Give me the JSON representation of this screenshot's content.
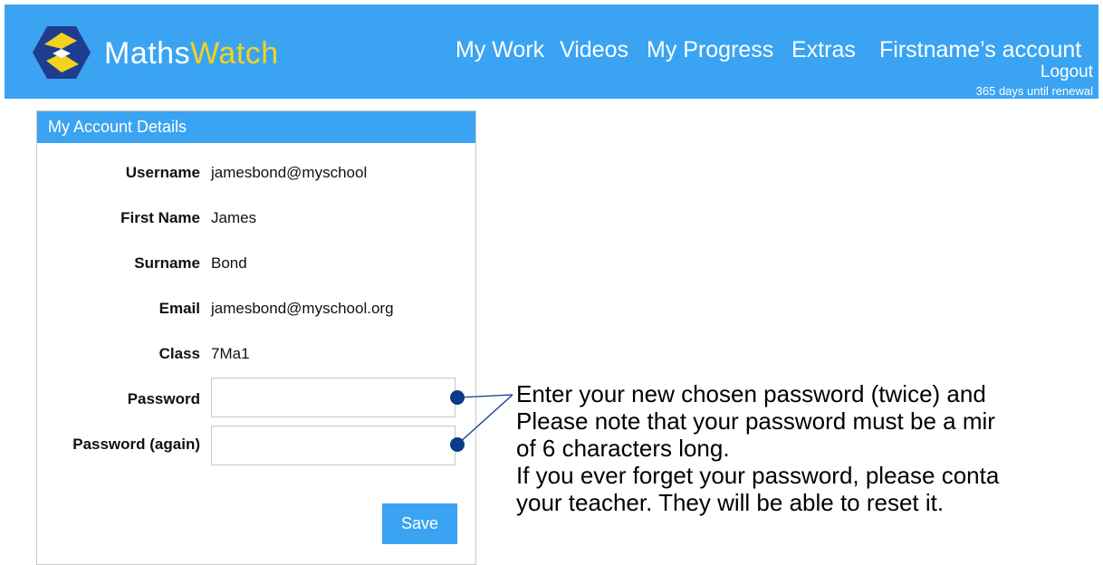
{
  "header": {
    "brand_part1": "Maths",
    "brand_part2": "Watch",
    "nav": [
      "My Work",
      "Videos",
      "My Progress",
      "Extras",
      "Firstname’s account"
    ],
    "logout": "Logout",
    "renewal": "365 days until renewal",
    "colors": {
      "bar": "#3aa4f2",
      "accent": "#f5d21d",
      "logo_bg": "#1f3d8f"
    }
  },
  "panel": {
    "title": "My Account Details",
    "fields": [
      {
        "label": "Username",
        "value": "jamesbond@myschool"
      },
      {
        "label": "First Name",
        "value": "James"
      },
      {
        "label": "Surname",
        "value": "Bond"
      },
      {
        "label": "Email",
        "value": "jamesbond@myschool.org"
      },
      {
        "label": "Class",
        "value": "7Ma1"
      }
    ],
    "password_label": "Password",
    "password_again_label": "Password (again)",
    "password_value": "",
    "password_again_value": "",
    "save_label": "Save"
  },
  "annotation": {
    "lines": [
      "Enter your new chosen password (twice) and",
      "Please note that your password must be a mir",
      "of 6 characters long.",
      "If you ever forget your password, please conta",
      "your teacher. They will be able to reset it."
    ],
    "marker_color": "#0d3a8a"
  }
}
